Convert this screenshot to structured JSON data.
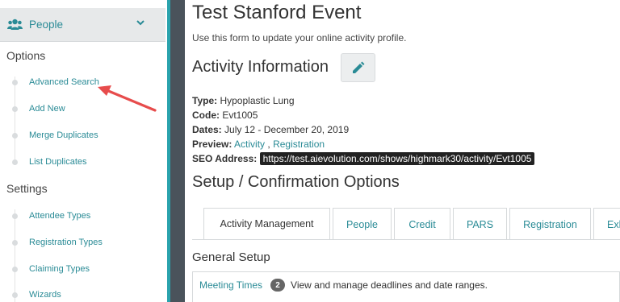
{
  "sidebar": {
    "header": {
      "label": "People",
      "icon": "users-icon"
    },
    "sections": [
      {
        "title": "Options",
        "items": [
          "Advanced Search",
          "Add New",
          "Merge Duplicates",
          "List Duplicates"
        ]
      },
      {
        "title": "Settings",
        "items": [
          "Attendee Types",
          "Registration Types",
          "Claiming Types",
          "Wizards"
        ]
      }
    ]
  },
  "main": {
    "title": "Test Stanford Event",
    "subtitle": "Use this form to update your online activity profile.",
    "activity_info": {
      "heading": "Activity Information",
      "type_label": "Type:",
      "type_value": "Hypoplastic Lung",
      "code_label": "Code:",
      "code_value": "Evt1005",
      "dates_label": "Dates:",
      "dates_value": "July 12 - December 20, 2019",
      "preview_label": "Preview:",
      "preview_activity": "Activity",
      "preview_sep": ",",
      "preview_registration": "Registration",
      "seo_label": "SEO Address:",
      "seo_value": "https://test.aievolution.com/shows/highmark30/activity/Evt1005"
    },
    "setup_heading": "Setup / Confirmation Options",
    "tabs": [
      "Activity Management",
      "People",
      "Credit",
      "PARS",
      "Registration",
      "Exh"
    ],
    "active_tab": "Activity Management",
    "general_setup": {
      "heading": "General Setup",
      "meeting_times_label": "Meeting Times",
      "meeting_times_count": "2",
      "meeting_times_desc": "View and manage deadlines and date ranges."
    }
  },
  "colors": {
    "accent": "#2aa3ad",
    "link": "#2a8b96",
    "gutter": "#4a535b",
    "arrow": "#e74c4c"
  }
}
